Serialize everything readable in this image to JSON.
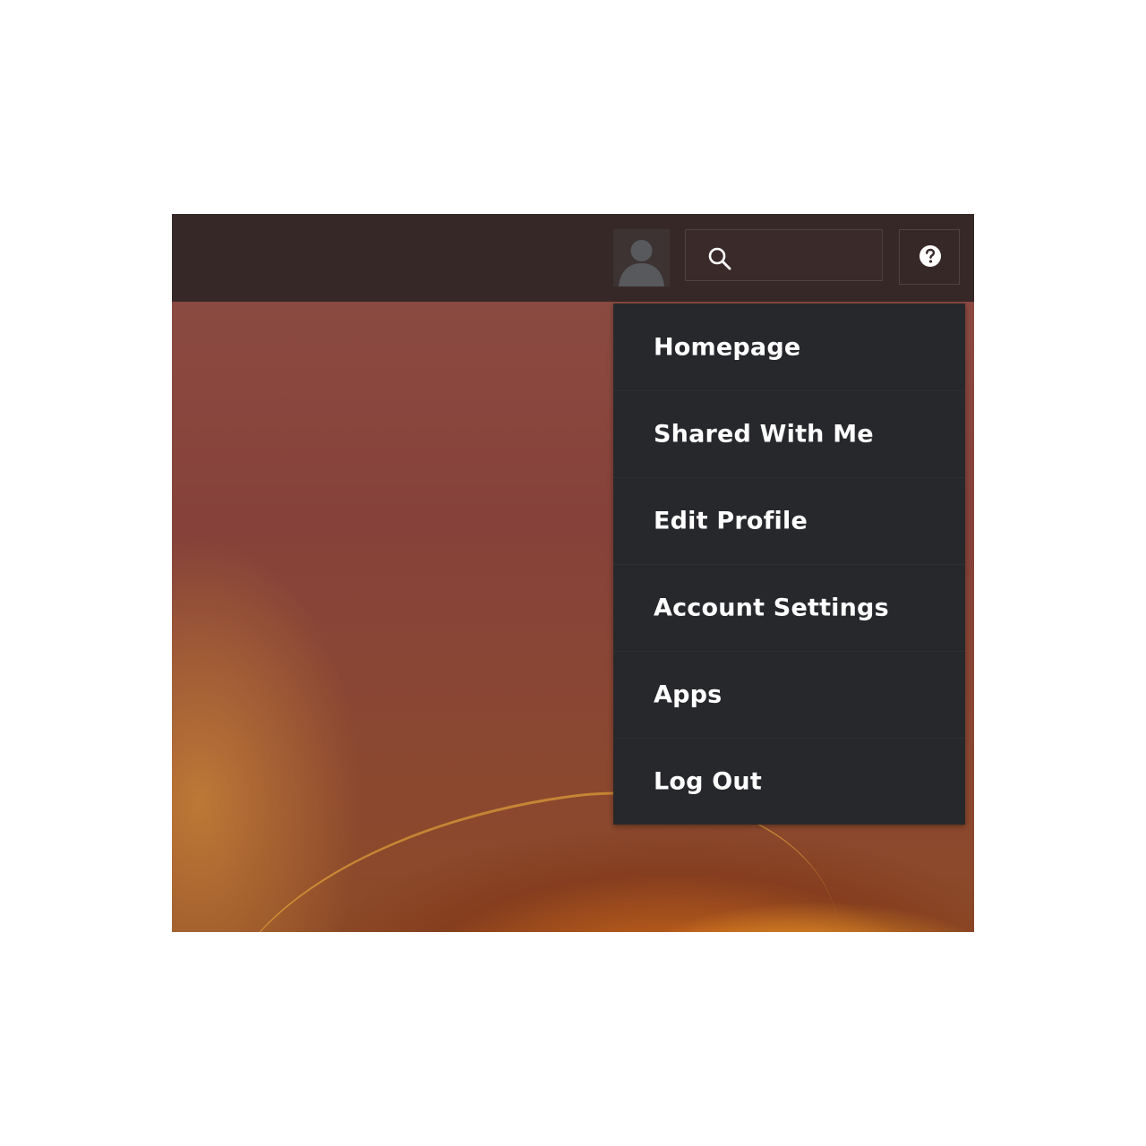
{
  "header": {
    "avatar_icon": "user-silhouette-icon",
    "search": {
      "icon": "search-icon",
      "value": "",
      "placeholder": ""
    },
    "help_icon": "question-circle-icon"
  },
  "user_menu": {
    "items": [
      {
        "label": "Homepage"
      },
      {
        "label": "Shared With Me"
      },
      {
        "label": "Edit Profile"
      },
      {
        "label": "Account Settings"
      },
      {
        "label": "Apps"
      },
      {
        "label": "Log Out"
      }
    ]
  },
  "colors": {
    "topbar": "#372828",
    "menu_bg": "#27282c",
    "menu_text": "#ffffff",
    "avatar_bg": "#3d3333"
  }
}
